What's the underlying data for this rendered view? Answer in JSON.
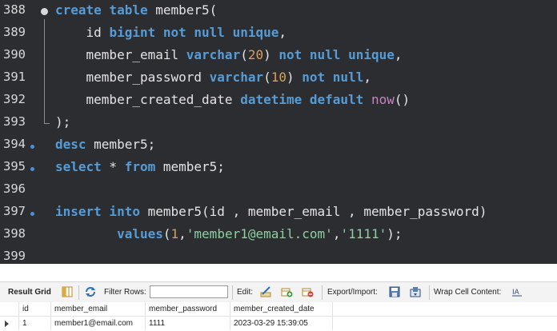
{
  "editor": {
    "lines": [
      {
        "num": "388",
        "code": "<span class=\"kw\">create table</span> member5("
      },
      {
        "num": "389",
        "code": "    id <span class=\"kw\">bigint not null unique</span>,"
      },
      {
        "num": "390",
        "code": "    member_email <span class=\"kw\">varchar</span>(<span class=\"num\">20</span>) <span class=\"kw\">not null unique</span>,"
      },
      {
        "num": "391",
        "code": "    member_password <span class=\"kw\">varchar</span>(<span class=\"num\">10</span>) <span class=\"kw\">not null</span>,"
      },
      {
        "num": "392",
        "code": "    member_created_date <span class=\"kw\">datetime default</span> <span class=\"fn\">now</span>()"
      },
      {
        "num": "393",
        "code": ");"
      },
      {
        "num": "394",
        "code": "<span class=\"kw\">desc</span> member5;"
      },
      {
        "num": "395",
        "code": "<span class=\"kw\">select</span> * <span class=\"kw\">from</span> member5;"
      },
      {
        "num": "396",
        "code": ""
      },
      {
        "num": "397",
        "code": "<span class=\"kw\">insert into</span> member5(id , member_email , member_password)"
      },
      {
        "num": "398",
        "code": "        <span class=\"kw\">values</span>(<span class=\"num\">1</span>,<span class=\"str\">'member1@email.com'</span>,<span class=\"str\">'1111'</span>);"
      },
      {
        "num": "399",
        "code": ""
      }
    ]
  },
  "result_panel": {
    "tab_label": "Result Grid",
    "filter_label": "Filter Rows:",
    "filter_value": "",
    "edit_label": "Edit:",
    "export_label": "Export/Import:",
    "wrap_label": "Wrap Cell Content:",
    "columns": [
      "id",
      "member_email",
      "member_password",
      "member_created_date"
    ],
    "rows": [
      [
        "1",
        "member1@email.com",
        "1111",
        "2023-03-29 15:39:05"
      ]
    ]
  },
  "colors": {
    "editor_bg": "#2b2d31",
    "keyword": "#569cd6",
    "function": "#c586c0",
    "number": "#d7a15a",
    "string": "#8fd0a0"
  }
}
